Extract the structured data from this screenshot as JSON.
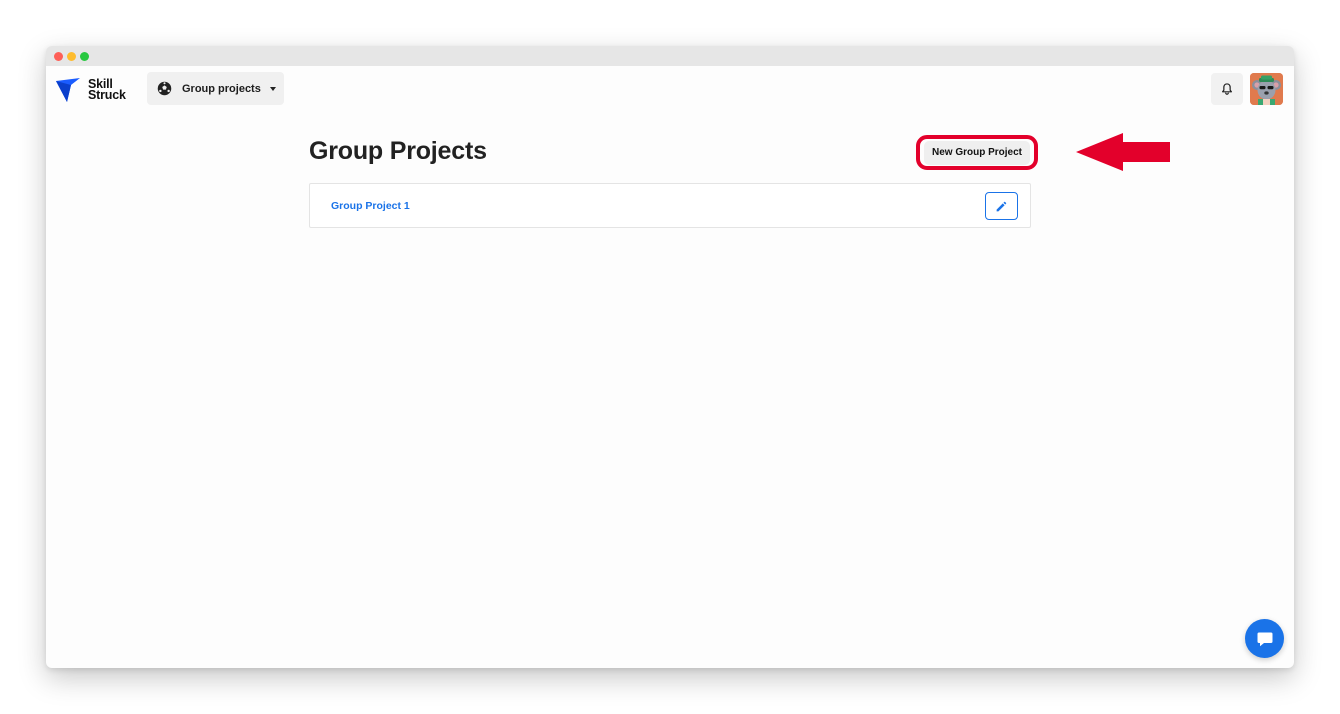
{
  "logo": {
    "line1": "Skill",
    "line2": "Struck",
    "brand_color": "#1a5cff"
  },
  "nav": {
    "group_selector_label": "Group projects",
    "icon": "soccer-ball-icon"
  },
  "header_actions": {
    "bell_icon": "bell-icon",
    "avatar": "user-avatar"
  },
  "main": {
    "title": "Group Projects",
    "new_button_label": "New Group Project",
    "projects": [
      {
        "name": "Group Project 1"
      }
    ]
  },
  "annotation": {
    "highlight_color": "#e3002b"
  },
  "chat": {
    "icon": "chat-icon"
  },
  "colors": {
    "accent": "#1a73e8"
  }
}
